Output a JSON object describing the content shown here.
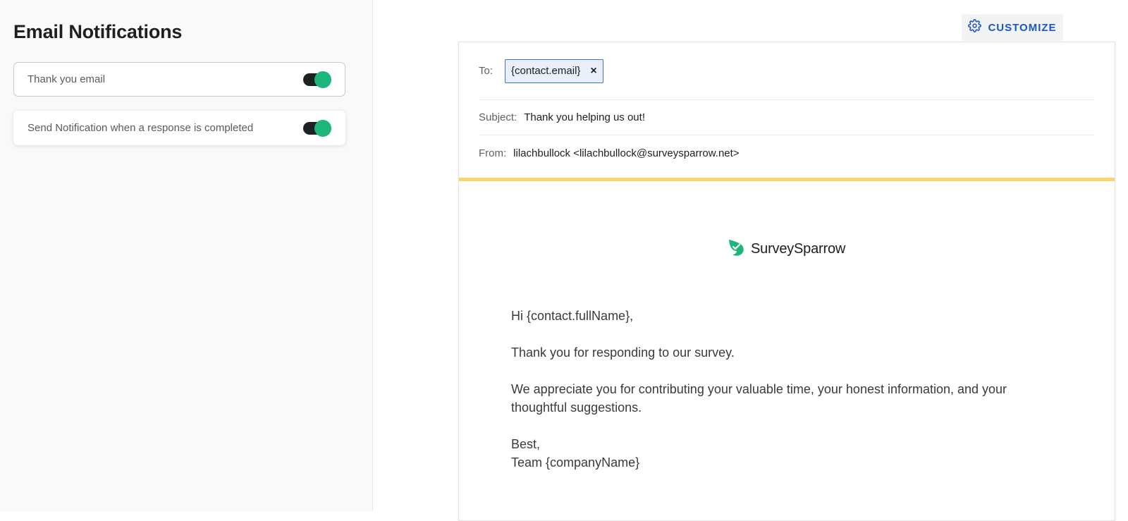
{
  "sidebar": {
    "title": "Email Notifications",
    "items": [
      {
        "label": "Thank you email",
        "enabled": true,
        "selected": true
      },
      {
        "label": "Send Notification when a response is completed",
        "enabled": true,
        "selected": false
      }
    ]
  },
  "toolbar": {
    "customize_label": "CUSTOMIZE",
    "customize_icon": "gear-icon"
  },
  "email": {
    "to_label": "To:",
    "to_chip": "{contact.email}",
    "chip_close": "×",
    "subject_label": "Subject:",
    "subject": "Thank you helping us out!",
    "from_label": "From:",
    "from": "lilachbullock <lilachbullock@surveysparrow.net>",
    "brand": "SurveySparrow",
    "body": {
      "greeting": "Hi {contact.fullName},",
      "line1": "Thank you for responding to our survey.",
      "line2": "We appreciate you for contributing your valuable time, your honest information, and your thoughtful suggestions.",
      "closing": "Best,",
      "signature": "Team {companyName}"
    }
  },
  "colors": {
    "accent_blue": "#1a56c6",
    "toggle_on": "#1db57a",
    "banner_yellow": "#f7d66b",
    "brand_green": "#1db57a"
  }
}
